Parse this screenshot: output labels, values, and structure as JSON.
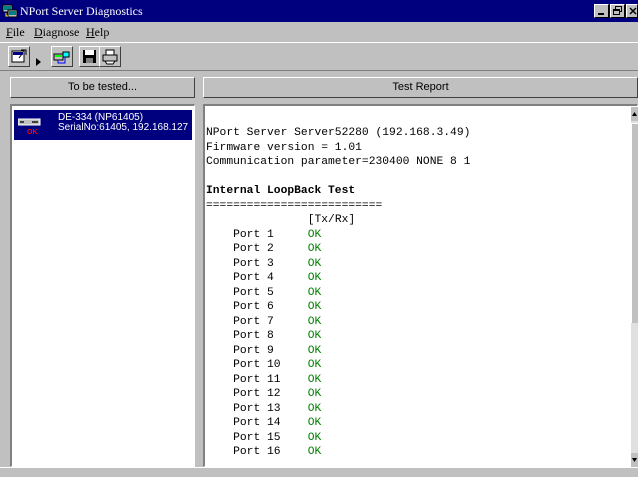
{
  "window": {
    "title": "NPort Server Diagnostics",
    "title_bar_color": "#00007f"
  },
  "menu": [
    {
      "label": "File"
    },
    {
      "label": "Diagnose"
    },
    {
      "label": "Help"
    }
  ],
  "toolbar": {
    "icons": [
      "properties-icon",
      "play-icon",
      "network-test-icon",
      "save-icon",
      "print-icon"
    ]
  },
  "panels": {
    "left_header": "To be tested...",
    "right_header": "Test Report"
  },
  "device": {
    "name": "DE-334 (NP61405)",
    "serial": "SerialNo:61405, 192.168.127",
    "status": "OK"
  },
  "report": {
    "server_line": "NPort Server Server52280 (192.168.3.49)",
    "firmware_line": "Firmware version = 1.01",
    "comm_line": "Communication parameter=230400 NONE 8 1",
    "test_title": "Internal LoopBack Test",
    "separator": "==========================",
    "column_header": "[Tx/Rx]",
    "ports": [
      {
        "port": "Port 1",
        "result": "OK"
      },
      {
        "port": "Port 2",
        "result": "OK"
      },
      {
        "port": "Port 3",
        "result": "OK"
      },
      {
        "port": "Port 4",
        "result": "OK"
      },
      {
        "port": "Port 5",
        "result": "OK"
      },
      {
        "port": "Port 6",
        "result": "OK"
      },
      {
        "port": "Port 7",
        "result": "OK"
      },
      {
        "port": "Port 8",
        "result": "OK"
      },
      {
        "port": "Port 9",
        "result": "OK"
      },
      {
        "port": "Port 10",
        "result": "OK"
      },
      {
        "port": "Port 11",
        "result": "OK"
      },
      {
        "port": "Port 12",
        "result": "OK"
      },
      {
        "port": "Port 13",
        "result": "OK"
      },
      {
        "port": "Port 14",
        "result": "OK"
      },
      {
        "port": "Port 15",
        "result": "OK"
      },
      {
        "port": "Port 16",
        "result": "OK"
      }
    ],
    "ok_color": "#008000"
  }
}
